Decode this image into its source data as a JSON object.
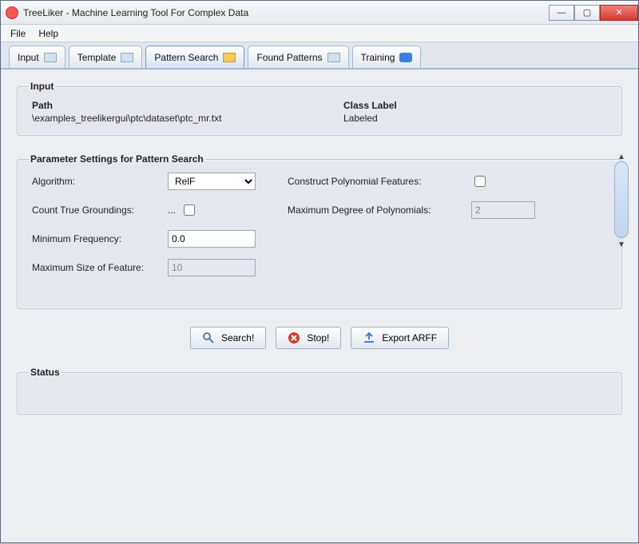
{
  "window": {
    "title": "TreeLiker - Machine Learning Tool For Complex Data"
  },
  "menu": {
    "file": "File",
    "help": "Help"
  },
  "tabs": {
    "input": "Input",
    "template": "Template",
    "pattern_search": "Pattern Search",
    "found_patterns": "Found Patterns",
    "training": "Training"
  },
  "panels": {
    "input_legend": "Input",
    "path_label": "Path",
    "path_value": "\\examples_treelikergui\\ptc\\dataset\\ptc_mr.txt",
    "class_label_label": "Class Label",
    "class_label_value": "Labeled",
    "params_legend": "Parameter Settings for Pattern Search",
    "status_legend": "Status"
  },
  "params": {
    "algorithm_label": "Algorithm:",
    "algorithm_value": "RelF",
    "count_true_label": "Count True Groundings:",
    "count_true_ellipsis": "...",
    "min_freq_label": "Minimum Frequency:",
    "min_freq_value": "0.0",
    "max_size_label": "Maximum Size of Feature:",
    "max_size_value": "10",
    "construct_poly_label": "Construct Polynomial Features:",
    "max_degree_label": "Maximum Degree of Polynomials:",
    "max_degree_value": "2"
  },
  "buttons": {
    "search": "Search!",
    "stop": "Stop!",
    "export": "Export ARFF"
  }
}
